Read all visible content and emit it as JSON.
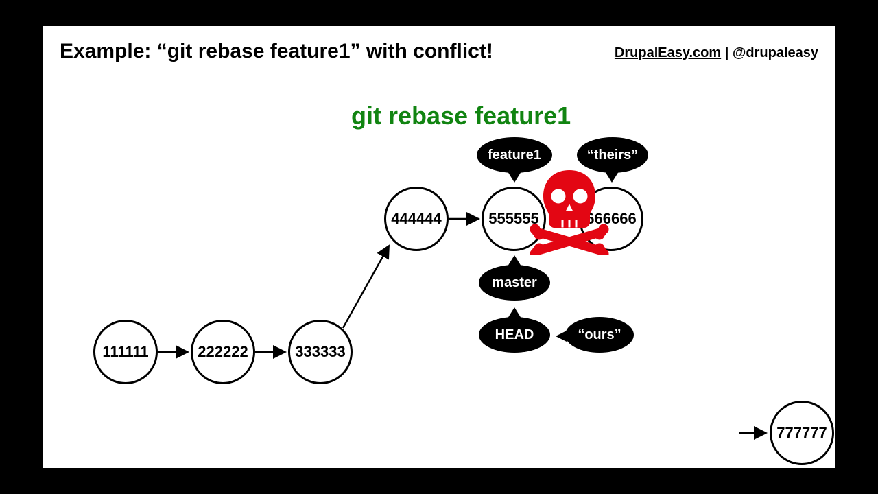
{
  "header": {
    "title": "Example: “git rebase feature1” with conflict!",
    "attribution_link": "DrupalEasy.com",
    "attribution_sep": " | ",
    "attribution_handle": "@drupaleasy"
  },
  "command": "git rebase feature1",
  "commits": {
    "c1": "111111",
    "c2": "222222",
    "c3": "333333",
    "c4": "444444",
    "c5": "555555",
    "c6": "666666",
    "c7": "777777"
  },
  "labels": {
    "feature1": "feature1",
    "theirs": "“theirs”",
    "master": "master",
    "head": "HEAD",
    "ours": "“ours”"
  }
}
